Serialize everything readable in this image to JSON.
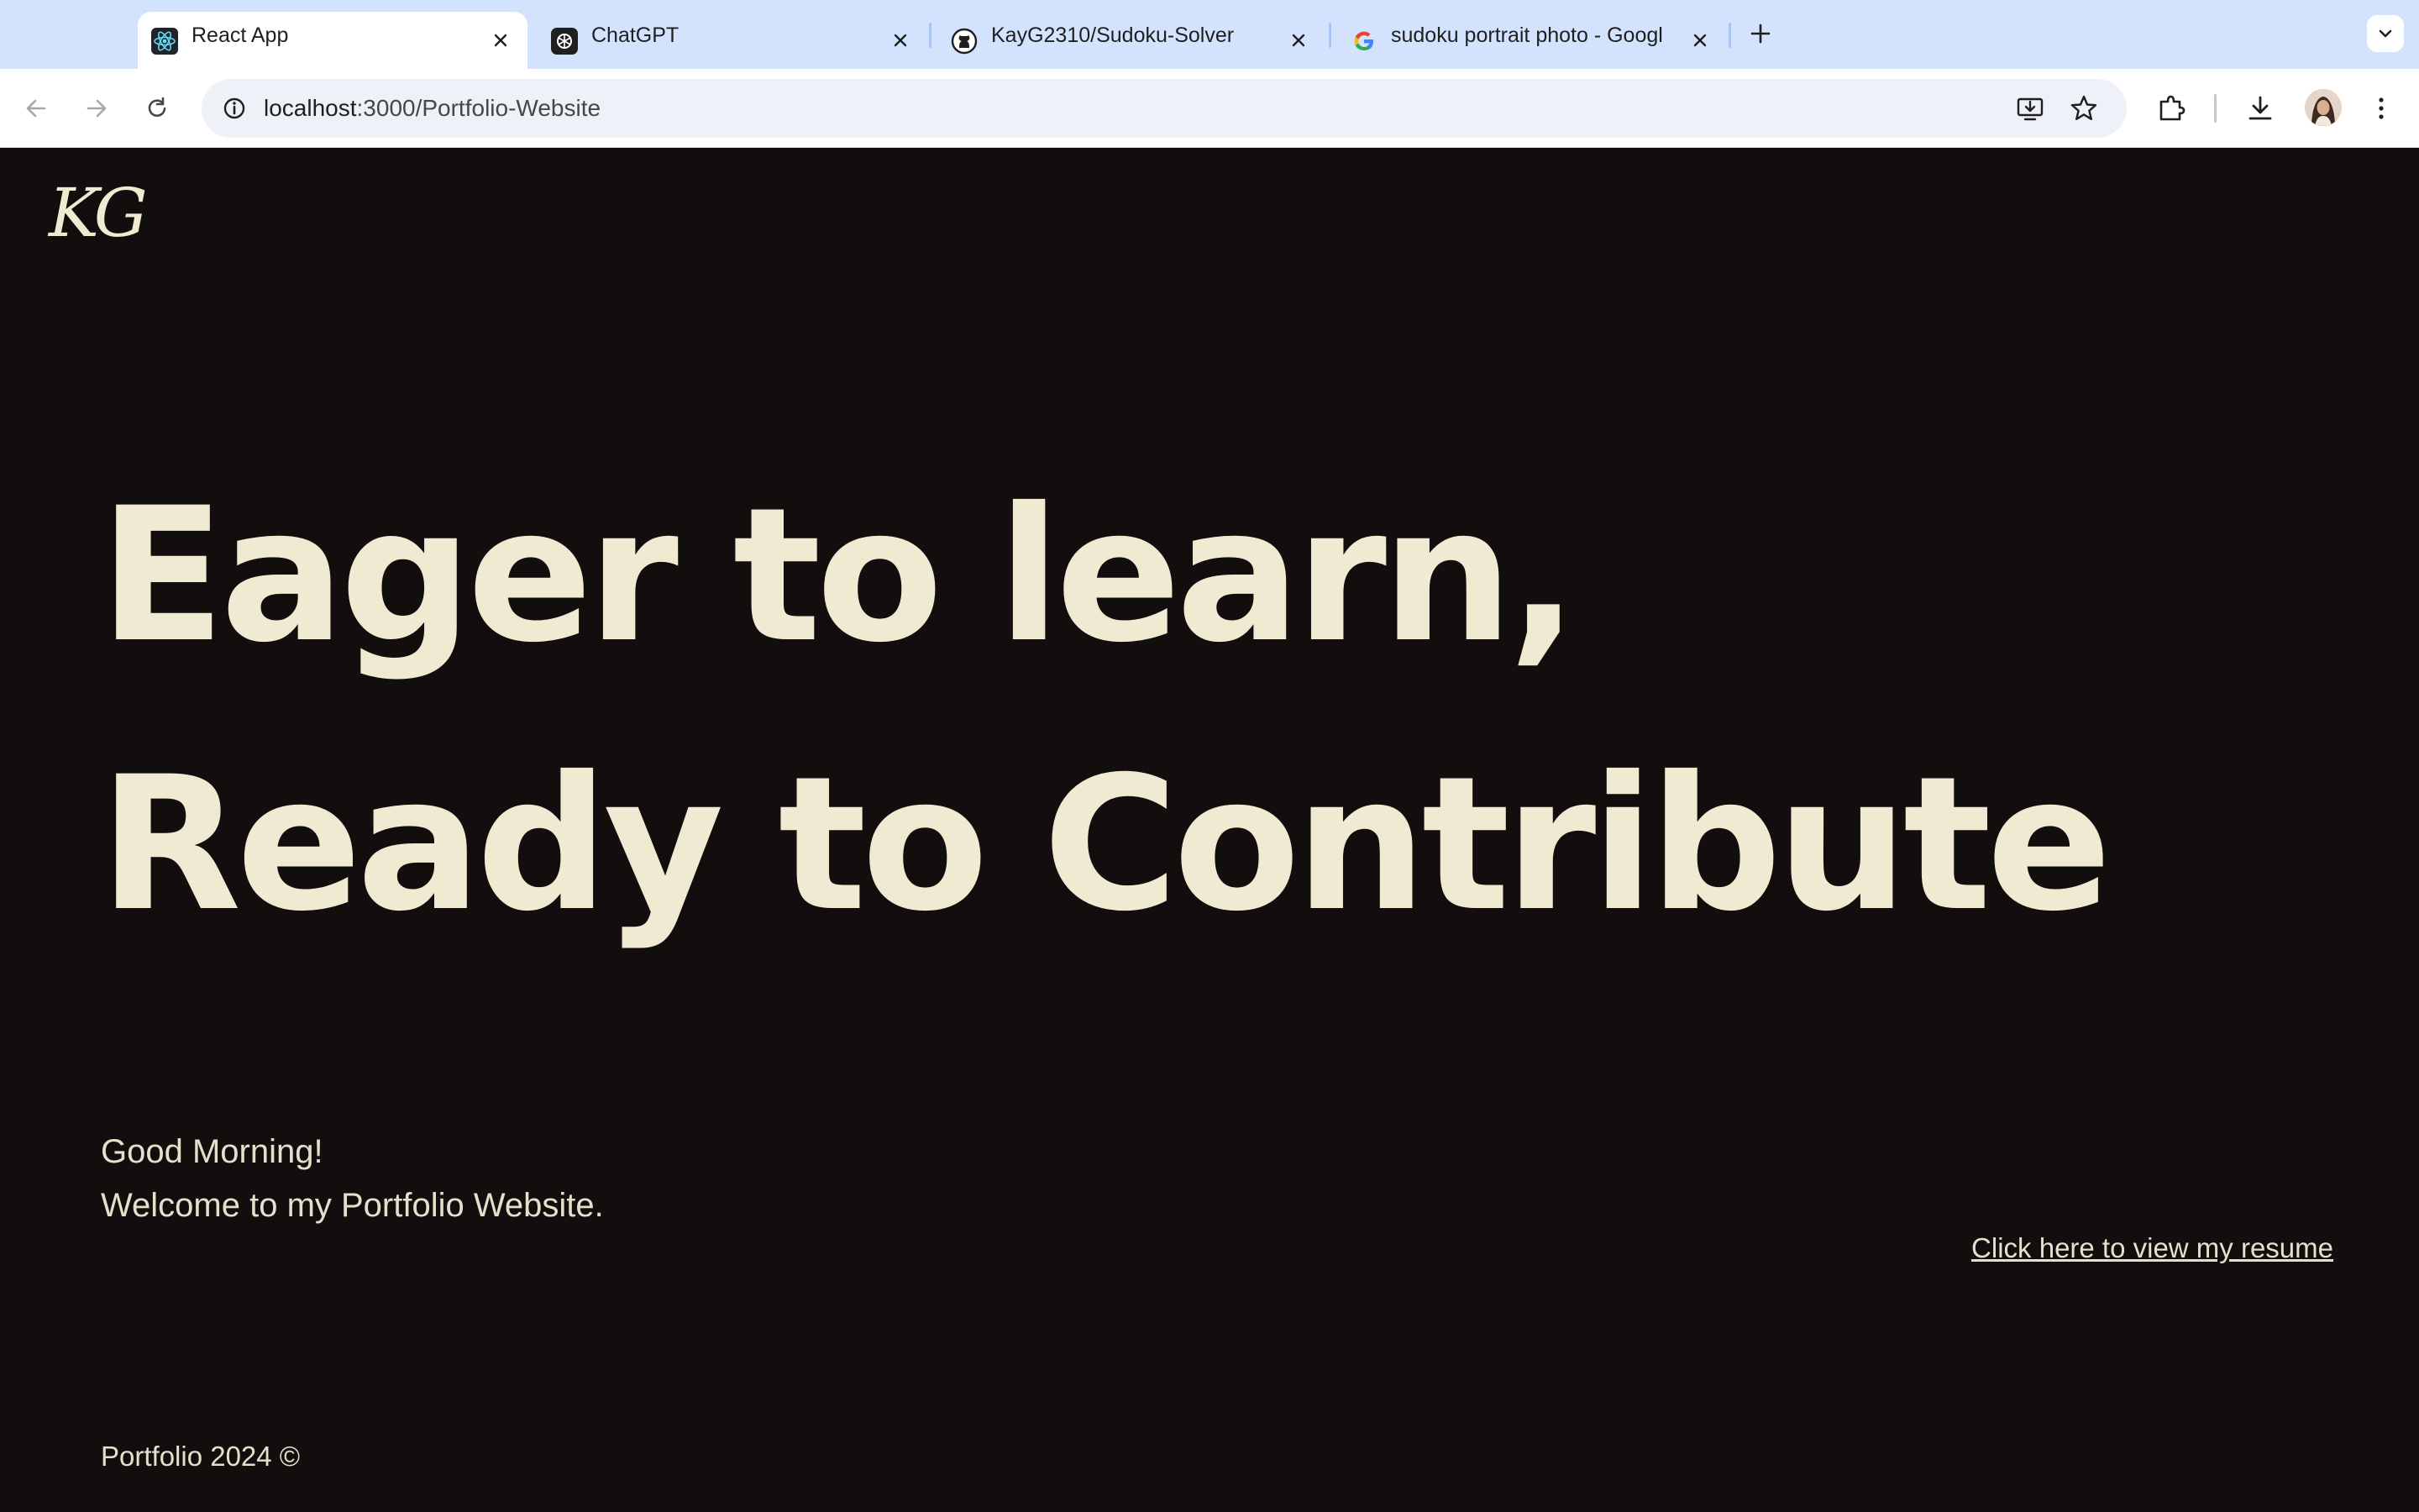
{
  "browser": {
    "tabs": [
      {
        "title": "React App",
        "favicon": "react-icon",
        "active": true
      },
      {
        "title": "ChatGPT",
        "favicon": "chatgpt-icon",
        "active": false
      },
      {
        "title": "KayG2310/Sudoku-Solver",
        "favicon": "github-icon",
        "active": false
      },
      {
        "title": "sudoku portrait photo - Googl",
        "favicon": "google-icon",
        "active": false
      }
    ],
    "new_tab_icon": "plus-icon",
    "tab_list_icon": "chevron-down-icon"
  },
  "toolbar": {
    "url_host": "localhost",
    "url_rest": ":3000/Portfolio-Website",
    "icons": [
      "back-arrow-icon",
      "forward-arrow-icon",
      "reload-icon",
      "site-info-icon",
      "install-app-icon",
      "bookmark-star-icon",
      "extensions-icon",
      "download-icon",
      "profile-avatar",
      "more-menu-icon"
    ]
  },
  "page": {
    "logo": "KG",
    "hero_line_1": "Eager to learn,",
    "hero_line_2": "Ready to Contribute",
    "greeting_line_1": "Good Morning!",
    "greeting_line_2": "Welcome to my Portfolio Website.",
    "resume_link": "Click here to view my resume",
    "footer": "Portfolio 2024 ©"
  },
  "colors": {
    "page_background": "#130e0e",
    "hero_text": "#f1ead2",
    "body_text": "#e6dfcb",
    "tabstrip": "#d3e3fd"
  }
}
